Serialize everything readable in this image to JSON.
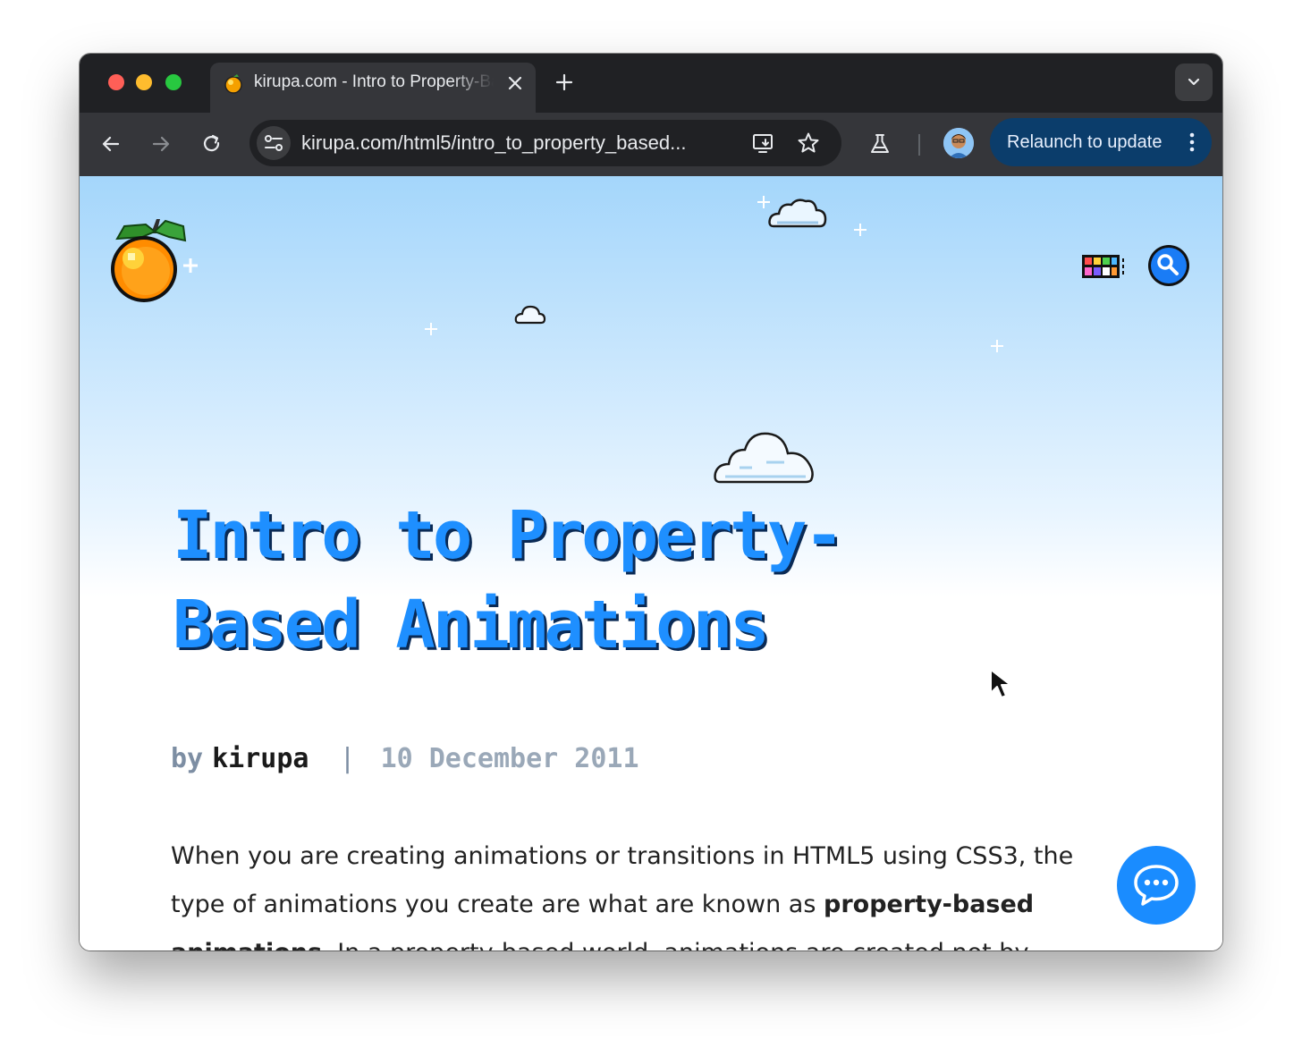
{
  "browser": {
    "tab": {
      "title": "kirupa.com - Intro to Property-Based Animations",
      "favicon": "kirupa-orange-favicon"
    },
    "toolbar": {
      "url": "kirupa.com/html5/intro_to_property_based...",
      "relaunch_label": "Relaunch to update"
    },
    "icons": [
      "close-icon",
      "plus-icon",
      "chevron-down-icon",
      "back-arrow-icon",
      "forward-arrow-icon",
      "reload-icon",
      "site-settings-icon",
      "install-app-icon",
      "star-icon",
      "labs-flask-icon",
      "profile-avatar",
      "more-vertical-icon"
    ]
  },
  "page": {
    "title": "Intro to Property-Based Animations",
    "byline": {
      "by": "by",
      "author": "kirupa",
      "separator": "|",
      "date": "10 December 2011"
    },
    "article": {
      "text_before_bold": "When you are creating animations or transitions in HTML5 using CSS3, the type of animations you create are what are known as ",
      "bold": "property-based animations",
      "text_after_bold": ". In a property-based world, animations are created not by"
    },
    "icons": [
      "kirupa-orange-logo",
      "color-grid-icon",
      "search-icon",
      "chat-icon",
      "mouse-cursor"
    ]
  },
  "colors": {
    "title_blue": "#1e8fff",
    "relaunch_bg": "#0b3d6b",
    "chat_button": "#1a8cff",
    "sky_top": "#a4d6fb"
  }
}
